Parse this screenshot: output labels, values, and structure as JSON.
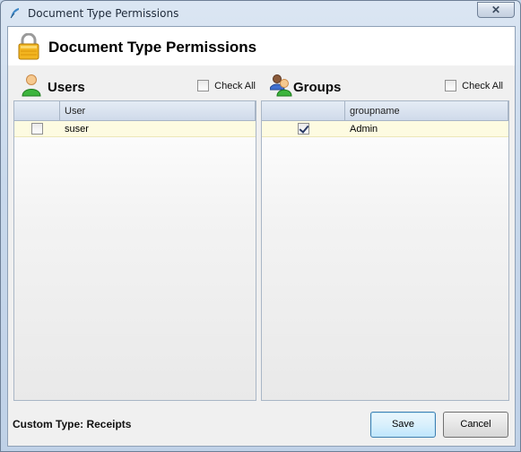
{
  "window": {
    "title": "Document Type Permissions",
    "close_label": "✕"
  },
  "header": {
    "title": "Document Type Permissions",
    "icon": "lock-icon"
  },
  "users": {
    "title": "Users",
    "icon": "user-icon",
    "check_all_label": "Check All",
    "check_all_checked": false,
    "columns": [
      "",
      "User"
    ],
    "rows": [
      {
        "checked": false,
        "name": "suser"
      }
    ]
  },
  "groups": {
    "title": "Groups",
    "icon": "group-icon",
    "check_all_label": "Check All",
    "check_all_checked": false,
    "columns": [
      "",
      "groupname"
    ],
    "rows": [
      {
        "checked": true,
        "name": "Admin"
      }
    ]
  },
  "footer": {
    "custom_type_label": "Custom Type: Receipts",
    "save_label": "Save",
    "cancel_label": "Cancel"
  },
  "colors": {
    "row_highlight": "#fdfbe1",
    "grid_header": "#d6e0ee",
    "save_focus_border": "#3c7fb1"
  }
}
